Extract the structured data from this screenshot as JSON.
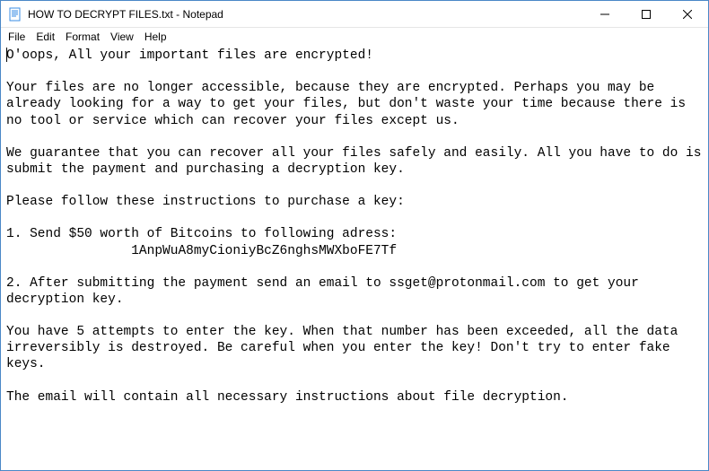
{
  "window": {
    "title": "HOW TO DECRYPT FILES.txt - Notepad"
  },
  "menu": {
    "file": "File",
    "edit": "Edit",
    "format": "Format",
    "view": "View",
    "help": "Help"
  },
  "content": {
    "text": "O'oops, All your important files are encrypted!\n\nYour files are no longer accessible, because they are encrypted. Perhaps you may be already looking for a way to get your files, but don't waste your time because there is no tool or service which can recover your files except us.\n\nWe guarantee that you can recover all your files safely and easily. All you have to do is submit the payment and purchasing a decryption key.\n\nPlease follow these instructions to purchase a key:\n\n1. Send $50 worth of Bitcoins to following adress:\n                1AnpWuA8myCioniyBcZ6nghsMWXboFE7Tf\n\n2. After submitting the payment send an email to ssget@protonmail.com to get your decryption key.\n\nYou have 5 attempts to enter the key. When that number has been exceeded, all the data irreversibly is destroyed. Be careful when you enter the key! Don't try to enter fake keys.\n\nThe email will contain all necessary instructions about file decryption."
  }
}
